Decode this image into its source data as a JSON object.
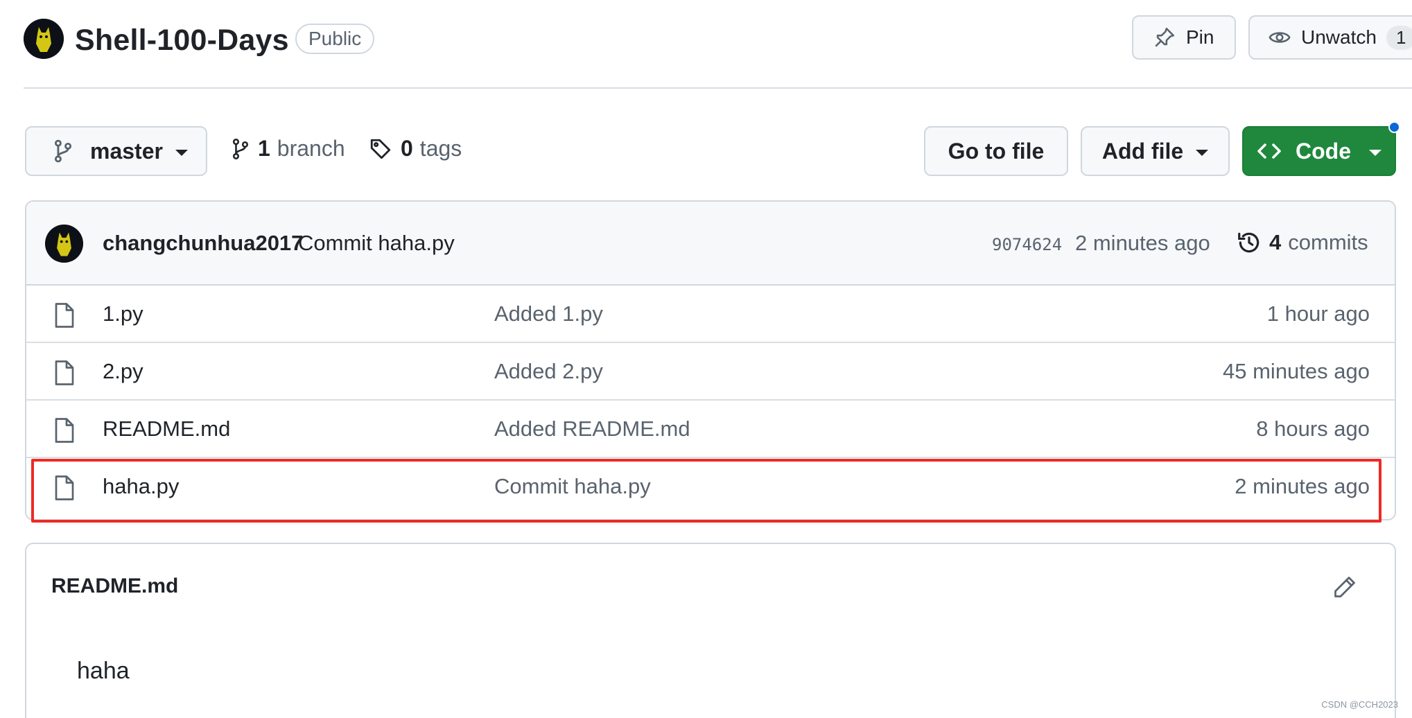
{
  "repo": {
    "name": "Shell-100-Days",
    "visibility": "Public"
  },
  "header_actions": {
    "pin_label": "Pin",
    "unwatch_label": "Unwatch",
    "watch_count": "1"
  },
  "toolbar": {
    "branch": "master",
    "branch_count": "1",
    "branch_label": "branch",
    "tag_count": "0",
    "tag_label": "tags",
    "go_to_file": "Go to file",
    "add_file": "Add file",
    "code": "Code"
  },
  "latest_commit": {
    "author": "changchunhua2017",
    "message": "Commit haha.py",
    "sha": "9074624",
    "age": "2 minutes ago",
    "commit_count": "4",
    "commit_label": "commits"
  },
  "files": [
    {
      "name": "1.py",
      "message": "Added 1.py",
      "age": "1 hour ago"
    },
    {
      "name": "2.py",
      "message": "Added 2.py",
      "age": "45 minutes ago"
    },
    {
      "name": "README.md",
      "message": "Added README.md",
      "age": "8 hours ago"
    },
    {
      "name": "haha.py",
      "message": "Commit haha.py",
      "age": "2 minutes ago"
    }
  ],
  "readme": {
    "title": "README.md",
    "content": "haha"
  },
  "watermark": "CSDN @CCH2023",
  "colors": {
    "primary_button": "#1f883d",
    "highlight_box": "#ee2a24",
    "notification_dot": "#0969da"
  }
}
